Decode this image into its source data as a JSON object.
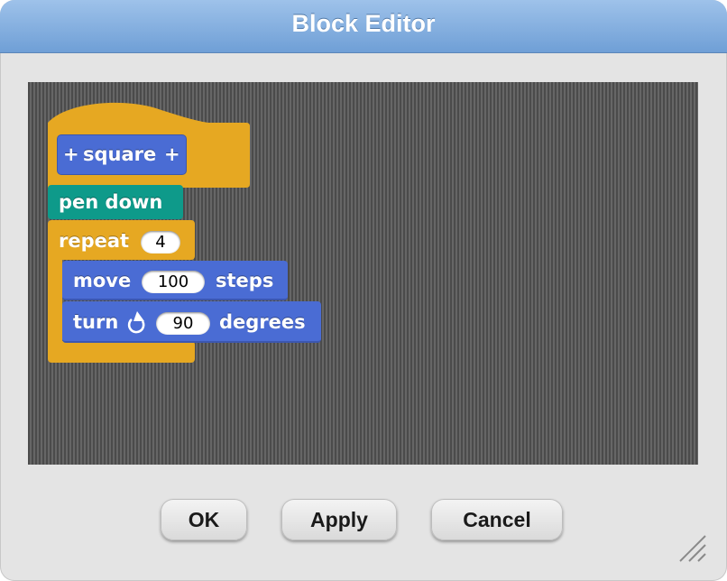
{
  "window": {
    "title": "Block Editor"
  },
  "script": {
    "hat": {
      "prefix": "+",
      "label": "square",
      "suffix": "+"
    },
    "pen_down": {
      "label": "pen down"
    },
    "repeat": {
      "label": "repeat",
      "count": "4"
    },
    "move": {
      "label": "move",
      "value": "100",
      "suffix": "steps"
    },
    "turn": {
      "label": "turn",
      "icon": "clockwise-arrow-icon",
      "value": "90",
      "suffix": "degrees"
    }
  },
  "buttons": {
    "ok": "OK",
    "apply": "Apply",
    "cancel": "Cancel"
  },
  "colors": {
    "titlebar": "#7fabdf",
    "control": "#e6a822",
    "custom": "#4a6cd4",
    "pen": "#0e9a8a",
    "motion": "#4a6cd4",
    "background": "#e4e4e4"
  }
}
